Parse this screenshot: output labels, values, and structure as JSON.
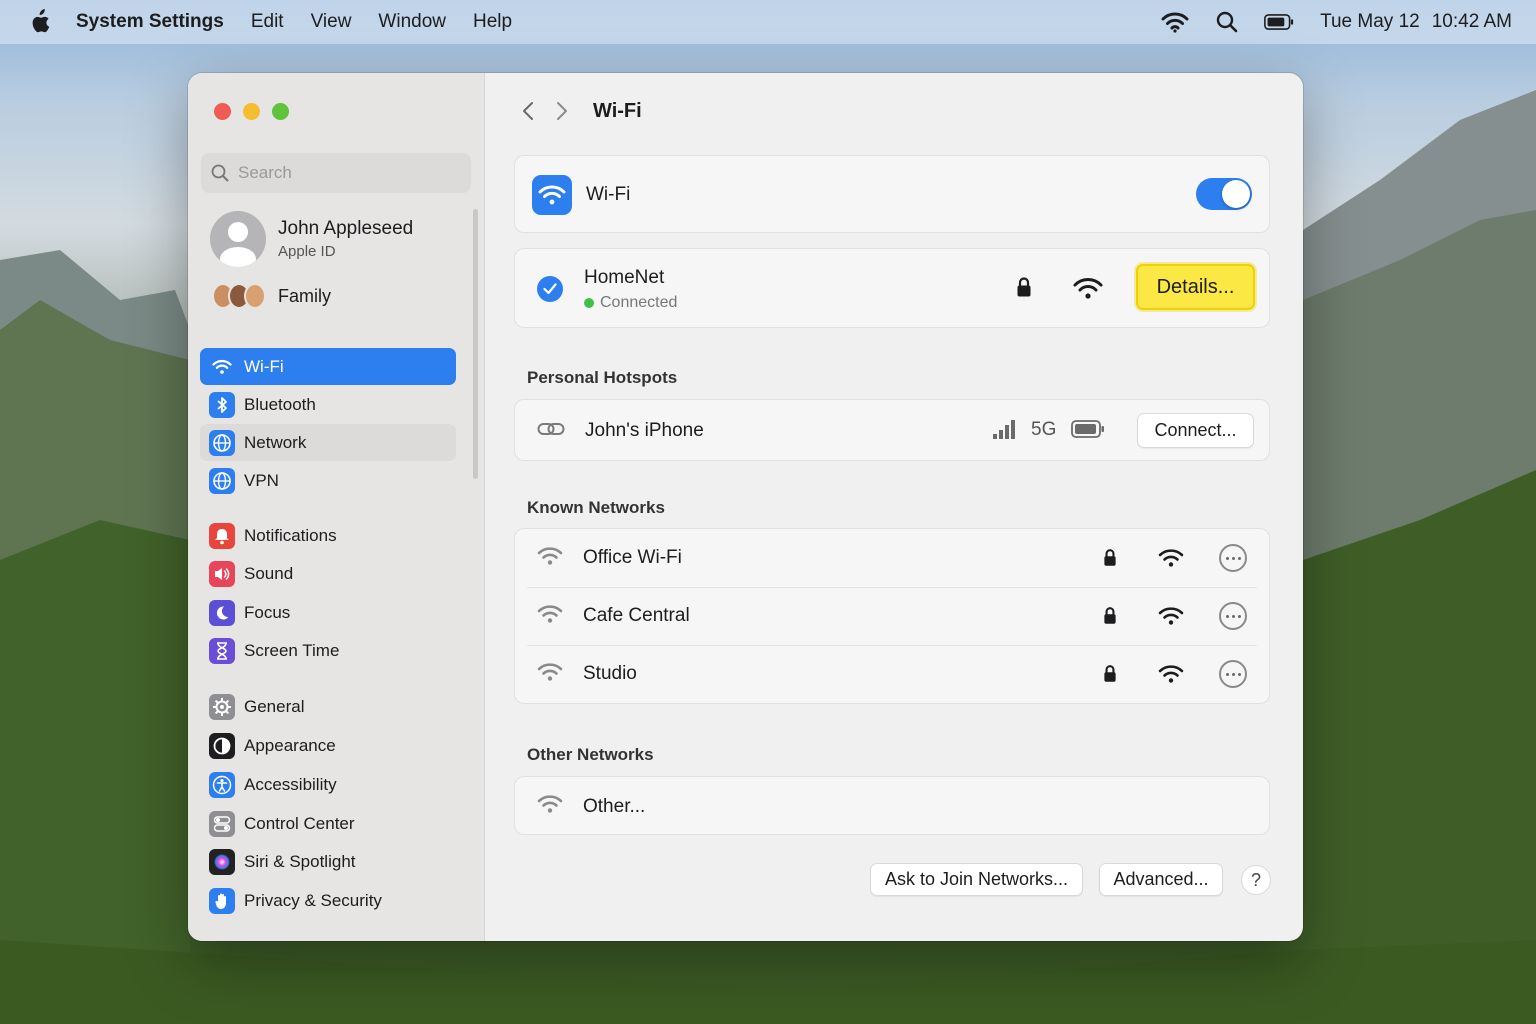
{
  "menubar": {
    "app_name": "System Settings",
    "items": [
      "Edit",
      "View",
      "Window",
      "Help"
    ],
    "date": "Tue May 12",
    "time": "10:42 AM"
  },
  "sidebar": {
    "search_placeholder": "Search",
    "profile": {
      "name": "John Appleseed",
      "subtitle": "Apple ID"
    },
    "family_label": "Family",
    "items": [
      {
        "label": "Wi-Fi",
        "icon": "wifi-icon",
        "color": "#2d7ff0"
      },
      {
        "label": "Bluetooth",
        "icon": "bluetooth-icon",
        "color": "#2d7ff0"
      },
      {
        "label": "Network",
        "icon": "globe-icon",
        "color": "#2d7ff0"
      },
      {
        "label": "VPN",
        "icon": "globe-icon",
        "color": "#2d7ff0"
      },
      {
        "label": "Notifications",
        "icon": "bell-icon",
        "color": "#e8453c"
      },
      {
        "label": "Sound",
        "icon": "speaker-icon",
        "color": "#e8455a"
      },
      {
        "label": "Focus",
        "icon": "moon-icon",
        "color": "#5b4fd6"
      },
      {
        "label": "Screen Time",
        "icon": "hourglass-icon",
        "color": "#6a4fd6"
      },
      {
        "label": "General",
        "icon": "gear-icon",
        "color": "#8e8e93"
      },
      {
        "label": "Appearance",
        "icon": "appearance-icon",
        "color": "#1d1d1f"
      },
      {
        "label": "Accessibility",
        "icon": "accessibility-icon",
        "color": "#2d7ff0"
      },
      {
        "label": "Control Center",
        "icon": "toggles-icon",
        "color": "#8e8e93"
      },
      {
        "label": "Siri & Spotlight",
        "icon": "siri-icon",
        "color": "#222"
      },
      {
        "label": "Privacy & Security",
        "icon": "hand-icon",
        "color": "#2d7ff0"
      }
    ]
  },
  "main": {
    "title": "Wi-Fi",
    "wifi_toggle_label": "Wi-Fi",
    "wifi_on": true,
    "current": {
      "name": "HomeNet",
      "status": "Connected",
      "details_button": "Details..."
    },
    "hotspots_heading": "Personal Hotspots",
    "hotspot": {
      "name": "John's iPhone",
      "network_type": "5G",
      "connect_button": "Connect..."
    },
    "known_heading": "Known Networks",
    "known": [
      {
        "name": "Office Wi-Fi"
      },
      {
        "name": "Cafe Central"
      },
      {
        "name": "Studio"
      }
    ],
    "other_heading": "Other Networks",
    "other_label": "Other...",
    "ask_join_button": "Ask to Join Networks...",
    "advanced_button": "Advanced...",
    "help_label": "?"
  }
}
